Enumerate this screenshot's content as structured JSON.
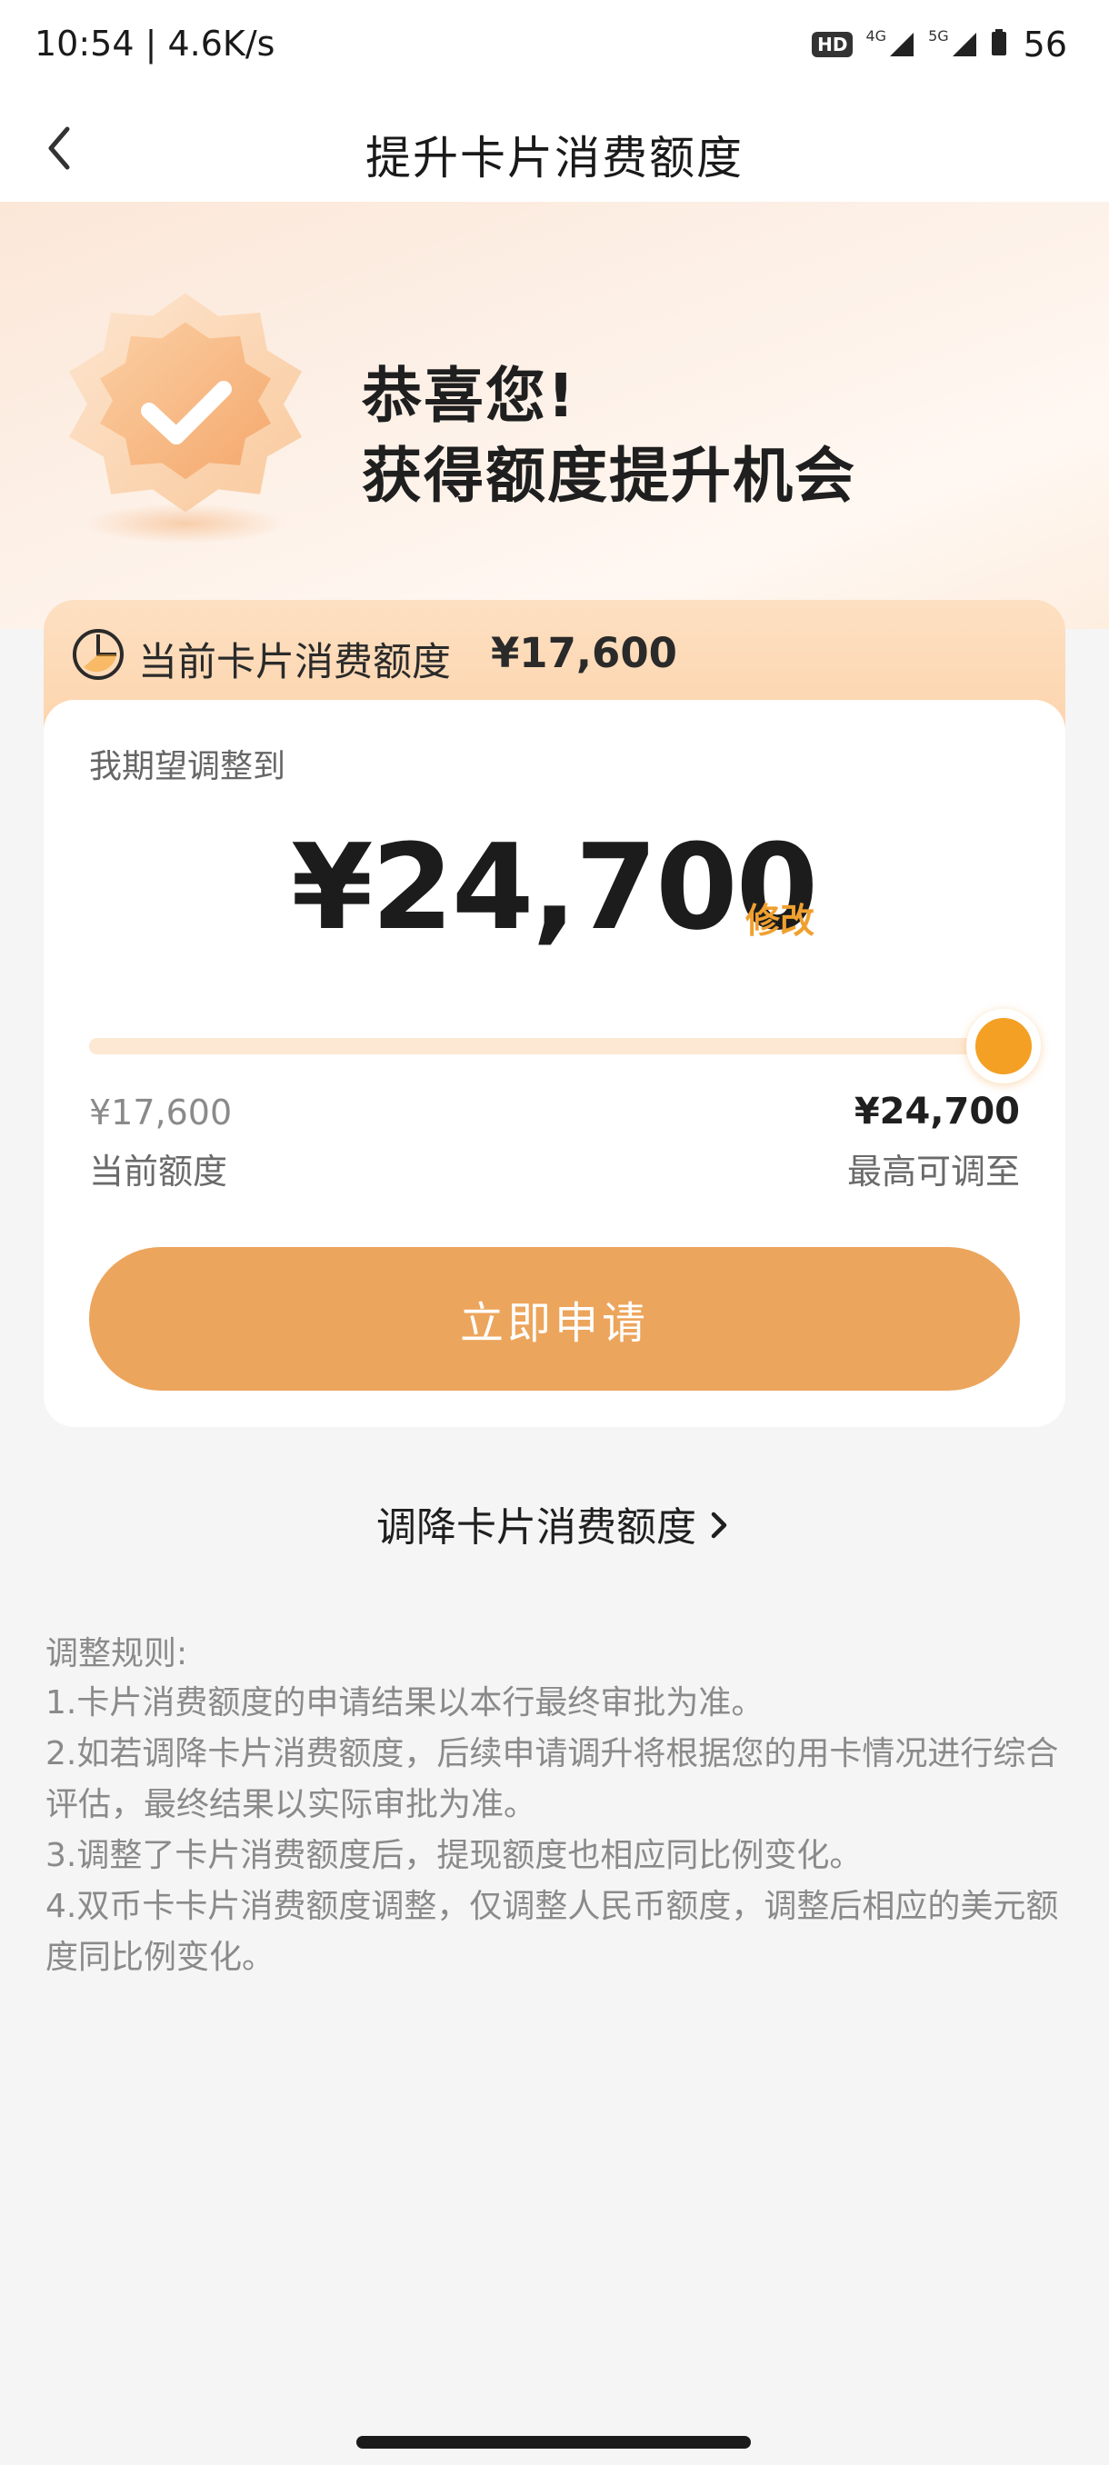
{
  "status_bar": {
    "time": "10:54",
    "speed": "4.6K/s",
    "hd_badge": "HD",
    "network_1": "4G",
    "network_2": "5G",
    "battery": "56"
  },
  "nav": {
    "title": "提升卡片消费额度"
  },
  "hero": {
    "line1": "恭喜您!",
    "line2": "获得额度提升机会"
  },
  "card": {
    "current_label": "当前卡片消费额度",
    "current_amount": "¥17,600",
    "expect_label": "我期望调整到",
    "target_amount": "¥24,700",
    "edit_label": "修改",
    "slider": {
      "level": 1.0,
      "min_value": "¥17,600",
      "min_caption": "当前额度",
      "max_value": "¥24,700",
      "max_caption": "最高可调至"
    },
    "apply_button": "立即申请"
  },
  "decrease_link": "调降卡片消费额度",
  "rules": {
    "title": "调整规则:",
    "items": [
      "1.卡片消费额度的申请结果以本行最终审批为准。",
      "2.如若调降卡片消费额度，后续申请调升将根据您的用卡情况进行综合评估，最终结果以实际审批为准。",
      "3.调整了卡片消费额度后，提现额度也相应同比例变化。",
      "4.双币卡卡片消费额度调整，仅调整人民币额度，调整后相应的美元额度同比例变化。"
    ]
  },
  "colors": {
    "accent": "#f4a025",
    "button": "#eca55c",
    "track": "#fde8d3"
  }
}
